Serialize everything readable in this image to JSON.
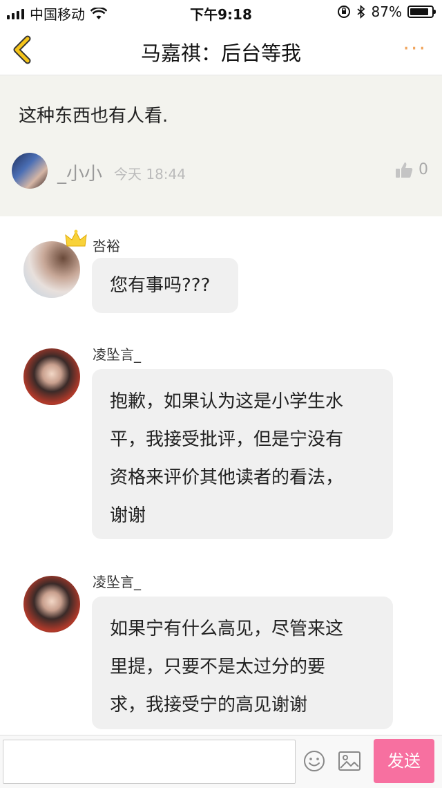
{
  "status_bar": {
    "carrier": "中国移动",
    "time": "下午9:18",
    "battery": "87%",
    "battery_level": 0.87
  },
  "nav": {
    "title": "马嘉祺：后台等我",
    "back_icon": "chevron-left-icon",
    "more_icon": "more-dots-icon",
    "accent_color": "#f5c41a"
  },
  "post": {
    "text": "这种东西也有人看.",
    "author": "_小小",
    "time": "今天 18:44",
    "likes": "0"
  },
  "comments": [
    {
      "author": "呇裕",
      "lines": [
        "您有事吗???"
      ],
      "badge": "crown-icon"
    },
    {
      "author": "凌坠言_",
      "lines": [
        "抱歉，如果认为这是小学生水",
        "平，我接受批评，但是宁没有",
        "资格来评价其他读者的看法，",
        "谢谢"
      ]
    },
    {
      "author": "凌坠言_",
      "lines": [
        "如果宁有什么高见，尽管来这",
        "里提，只要不是太过分的要",
        "求，我接受宁的高见谢谢"
      ]
    }
  ],
  "input_bar": {
    "placeholder": "",
    "send_label": "发送",
    "send_color": "#f770a0"
  }
}
